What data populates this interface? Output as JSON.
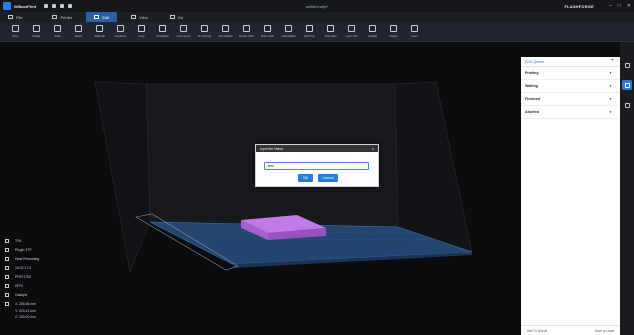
{
  "app": {
    "name": "WiiboxPrint",
    "document_title": "untitled.wiip*",
    "brand": "FLASHFORGE"
  },
  "window_controls": [
    "–",
    "□",
    "✕"
  ],
  "menu_tabs": [
    {
      "label": "File",
      "icon": "file-icon"
    },
    {
      "label": "Printer",
      "icon": "printer-icon"
    },
    {
      "label": "Edit",
      "icon": "edit-icon",
      "active": true
    },
    {
      "label": "View",
      "icon": "eye-icon"
    },
    {
      "label": "Go",
      "icon": "go-icon"
    }
  ],
  "toolbar": [
    {
      "label": "Move",
      "icon": "move-icon"
    },
    {
      "label": "Rotate",
      "icon": "rotate-icon"
    },
    {
      "label": "Scale",
      "icon": "scale-icon"
    },
    {
      "label": "Delete",
      "icon": "delete-icon"
    },
    {
      "label": "Select All",
      "icon": "select-all-icon"
    },
    {
      "label": "Duplicate",
      "icon": "duplicate-icon"
    },
    {
      "label": "Array",
      "icon": "array-icon"
    },
    {
      "label": "Orientation",
      "icon": "orientation-icon"
    },
    {
      "label": "Auto Layout",
      "icon": "auto-layout-icon"
    },
    {
      "label": "3D Painting",
      "icon": "paint-icon"
    },
    {
      "label": "Split Models",
      "icon": "split-models-icon"
    },
    {
      "label": "Extract Shell",
      "icon": "extract-shell-icon"
    },
    {
      "label": "Make Solid",
      "icon": "make-solid-icon"
    },
    {
      "label": "Add Modifier",
      "icon": "add-modifier-icon"
    },
    {
      "label": "Add Prop",
      "icon": "add-prop-icon"
    },
    {
      "label": "Add Label",
      "icon": "add-label-icon"
    },
    {
      "label": "Layer Part",
      "icon": "layer-part-icon"
    },
    {
      "label": "Coating",
      "icon": "coating-icon"
    },
    {
      "label": "Weight",
      "icon": "weight-icon"
    },
    {
      "label": "Insert",
      "icon": "insert-icon"
    }
  ],
  "dialog": {
    "title": "Input the Name",
    "value": "test",
    "ok": "OK",
    "cancel": "Cancel"
  },
  "info_panel": {
    "rows": [
      {
        "icon": "pla-icon",
        "text": "TPA"
      },
      {
        "icon": "plugin-icon",
        "text": "Plugin 3TP"
      },
      {
        "icon": "heat-icon",
        "text": "Heat Preventing"
      },
      {
        "icon": "clock-icon",
        "text": "16:22:17:4"
      },
      {
        "icon": "size-icon",
        "text": "PPAT1700"
      },
      {
        "icon": "speed-icon",
        "text": "0FF0"
      },
      {
        "icon": "gear-icon",
        "text": "Catalyst"
      },
      {
        "icon": "axis-icon",
        "text": "X: 285.66 mm"
      }
    ],
    "coords": [
      "Y: 220.12 mm",
      "Z: 150.00 mm"
    ]
  },
  "print_queue": {
    "title": "Print Queue",
    "sections": [
      "Printing",
      "Waiting",
      "Finished",
      "Aborted"
    ],
    "add_to_queue": "Add To Queue",
    "save_to_local": "Save to Local"
  },
  "colors": {
    "accent": "#2e7bd6",
    "model": "#b96fe0",
    "bed": "#2a5fa6"
  }
}
